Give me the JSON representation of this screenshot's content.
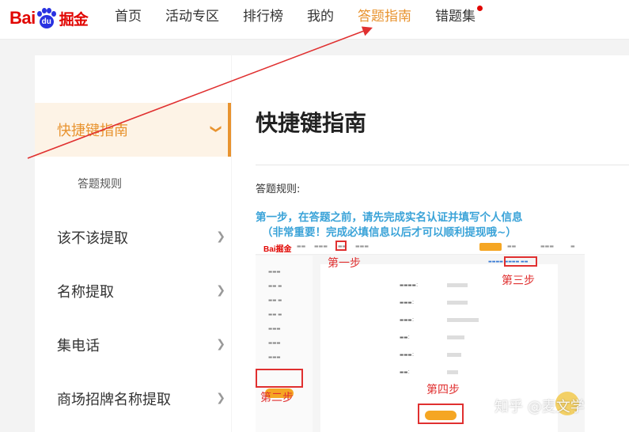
{
  "header": {
    "logo": {
      "bai": "Bai",
      "du": "du",
      "jue": "掘金"
    },
    "nav": [
      {
        "label": "首页",
        "active": false
      },
      {
        "label": "活动专区",
        "active": false
      },
      {
        "label": "排行榜",
        "active": false
      },
      {
        "label": "我的",
        "active": false
      },
      {
        "label": "答题指南",
        "active": true
      },
      {
        "label": "错题集",
        "active": false,
        "badge_dot": true
      }
    ]
  },
  "sidebar": {
    "items": [
      {
        "label": "快捷键指南",
        "active": true,
        "icon": "chevron-down-icon"
      },
      {
        "label": "答题规则",
        "sub": true
      },
      {
        "label": "该不该提取",
        "icon": "chevron-right-icon"
      },
      {
        "label": "名称提取",
        "icon": "chevron-right-icon"
      },
      {
        "label": "集电话",
        "icon": "chevron-right-icon"
      },
      {
        "label": "商场招牌名称提取",
        "icon": "chevron-right-icon"
      }
    ]
  },
  "main": {
    "title": "快捷键指南",
    "rules_label": "答题规则:",
    "step_instruction_line1": "第一步，在答题之前，请先完成实名认证并填写个人信息",
    "step_instruction_line2": "（非常重要！完成必填信息以后才可以顺利提现哦~）",
    "screenshot": {
      "logo": "Bai掘金",
      "step_labels": [
        "第一步",
        "第二步",
        "第三步",
        "第四步"
      ]
    }
  },
  "watermark": "知乎 @麦文学",
  "colors": {
    "accent": "#e8932f",
    "brand_red": "#e10602",
    "instruction_blue": "#3aa3d8",
    "annotation_red": "#e03030"
  }
}
